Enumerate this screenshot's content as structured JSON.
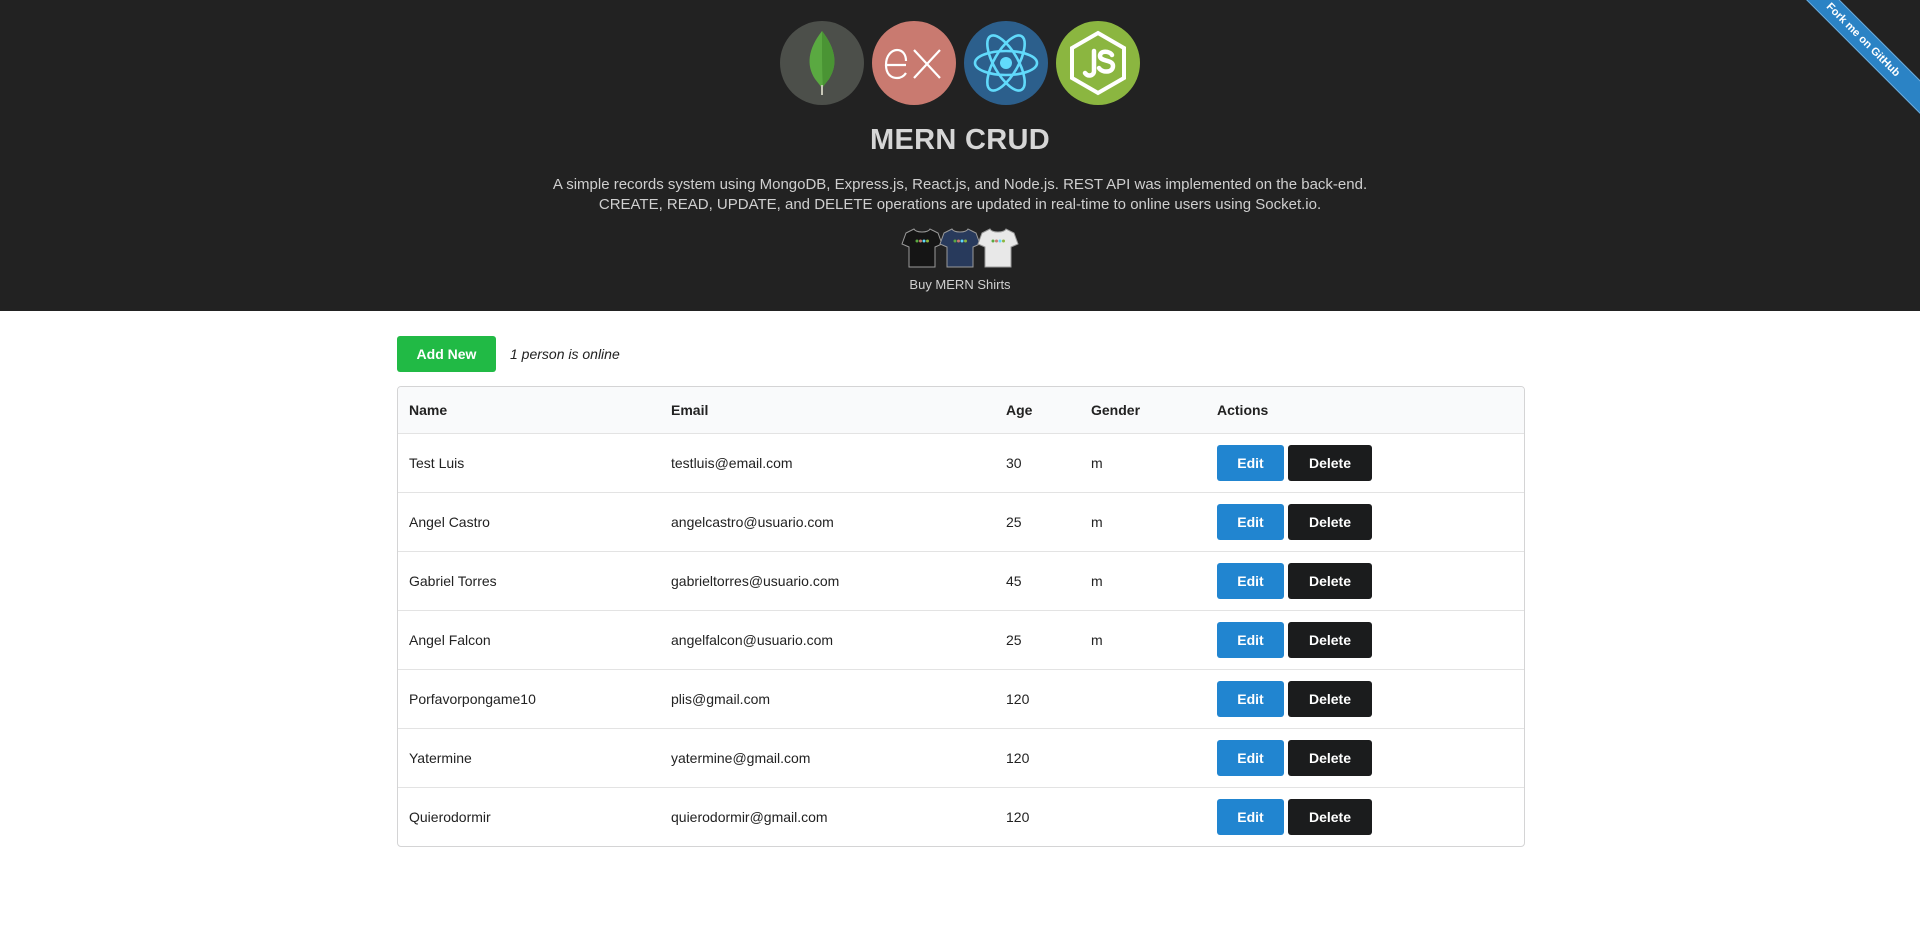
{
  "header": {
    "title": "MERN CRUD",
    "description_line1": "A simple records system using MongoDB, Express.js, React.js, and Node.js. REST API was implemented on the back-end.",
    "description_line2": "CREATE, READ, UPDATE, and DELETE operations are updated in real-time to online users using Socket.io.",
    "shirts_label": "Buy MERN Shirts",
    "logos": [
      "mongodb-logo",
      "express-logo",
      "react-logo",
      "nodejs-logo"
    ],
    "ribbon_label": "Fork me on GitHub",
    "colors": {
      "background": "#222222",
      "ribbon": "#2b83c5"
    }
  },
  "toolbar": {
    "add_label": "Add New",
    "online_status": "1 person is online"
  },
  "table": {
    "columns": [
      "Name",
      "Email",
      "Age",
      "Gender",
      "Actions"
    ],
    "rows": [
      {
        "name": "Test Luis",
        "email": "testluis@email.com",
        "age": "30",
        "gender": "m"
      },
      {
        "name": "Angel Castro",
        "email": "angelcastro@usuario.com",
        "age": "25",
        "gender": "m"
      },
      {
        "name": "Gabriel Torres",
        "email": "gabrieltorres@usuario.com",
        "age": "45",
        "gender": "m"
      },
      {
        "name": "Angel Falcon",
        "email": "angelfalcon@usuario.com",
        "age": "25",
        "gender": "m"
      },
      {
        "name": "Porfavorpongame10",
        "email": "plis@gmail.com",
        "age": "120",
        "gender": ""
      },
      {
        "name": "Yatermine",
        "email": "yatermine@gmail.com",
        "age": "120",
        "gender": ""
      },
      {
        "name": "Quierodormir",
        "email": "quierodormir@gmail.com",
        "age": "120",
        "gender": ""
      }
    ],
    "edit_label": "Edit",
    "delete_label": "Delete"
  },
  "colors": {
    "add": "#21ba45",
    "edit": "#2185d0",
    "delete": "#1b1c1d"
  }
}
